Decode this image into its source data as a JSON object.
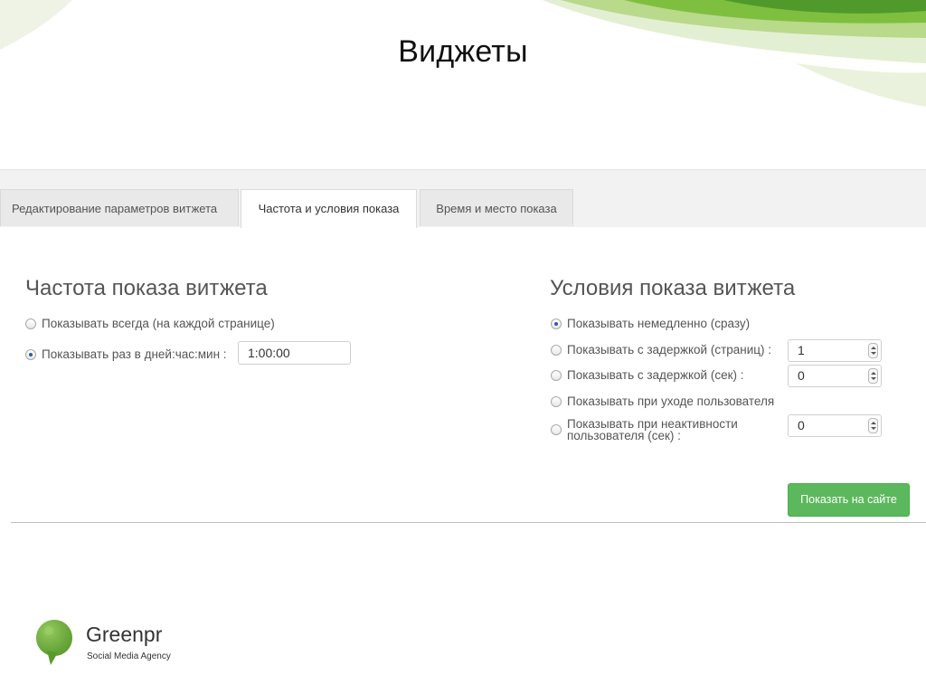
{
  "slide": {
    "title": "Виджеты"
  },
  "tabs": [
    {
      "label": "Редактирование параметров витжета",
      "active": false
    },
    {
      "label": "Частота и условия показа",
      "active": true
    },
    {
      "label": "Время и место показа",
      "active": false
    }
  ],
  "frequency": {
    "title": "Частота показа витжета",
    "options": [
      {
        "label": "Показывать всегда (на каждой странице)",
        "checked": false
      },
      {
        "label": "Показывать раз в дней:час:мин :",
        "checked": true
      }
    ],
    "interval_value": "1:00:00"
  },
  "conditions": {
    "title": "Условия показа витжета",
    "options": [
      {
        "label": "Показывать немедленно (сразу)",
        "checked": true
      },
      {
        "label": "Показывать с задержкой (страниц) :",
        "checked": false,
        "value": "1"
      },
      {
        "label": "Показывать с задержкой (сек) :",
        "checked": false,
        "value": "0"
      },
      {
        "label": "Показывать при уходе пользователя",
        "checked": false
      },
      {
        "label": "Показывать при неактивности пользователя (сек) :",
        "checked": false,
        "value": "0"
      }
    ]
  },
  "actions": {
    "show_on_site": "Показать на сайте"
  },
  "brand": {
    "name": "Greenpr",
    "tagline": "Social Media Agency",
    "accent": "#5cb85c",
    "logo_color": "#6aaa3a"
  }
}
